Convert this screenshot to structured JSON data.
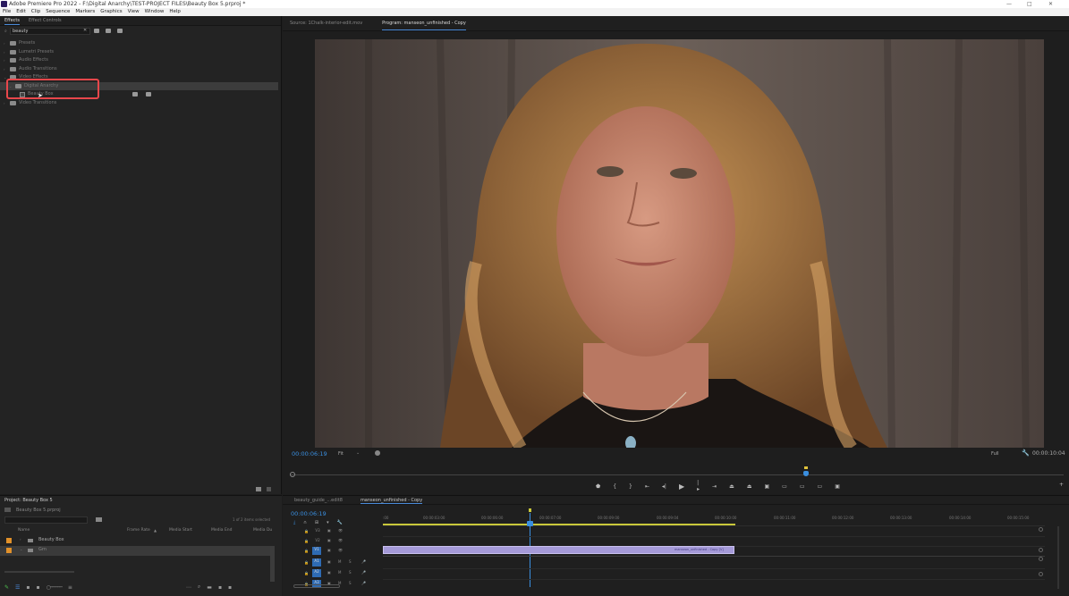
{
  "app": {
    "title": "Adobe Premiere Pro 2022 - F:\\Digital Anarchy\\TEST-PROJECT FILES\\Beauty Box 5.prproj *",
    "window_controls": [
      "—",
      "□",
      "✕"
    ]
  },
  "menu": [
    "File",
    "Edit",
    "Clip",
    "Sequence",
    "Markers",
    "Graphics",
    "View",
    "Window",
    "Help"
  ],
  "effects_panel": {
    "tabs": [
      "Effects",
      "Effect Controls"
    ],
    "search_value": "beauty",
    "tree": [
      {
        "label": "Presets",
        "expanded": false
      },
      {
        "label": "Lumetri Presets",
        "expanded": false
      },
      {
        "label": "Audio Effects",
        "expanded": false
      },
      {
        "label": "Audio Transitions",
        "expanded": false
      },
      {
        "label": "Video Effects",
        "expanded": true
      },
      {
        "label": "Digital Anarchy",
        "expanded": true,
        "selected": true
      },
      {
        "label": "Beauty Box",
        "is_effect": true
      },
      {
        "label": "Video Transitions",
        "expanded": false
      }
    ],
    "highlight_color": "#e8474b"
  },
  "program_monitor": {
    "tabs": [
      "Source: 1Chalk-interior-edit.mov",
      "Program: manseon_unfinished - Copy"
    ],
    "timecode_current": "00:00:06:19",
    "fit": "Fit",
    "quality": "Full",
    "timecode_duration": "00:00:10:04"
  },
  "project_panel": {
    "title": "Project: Beauty Box 5",
    "file": "Beauty Box 5.prproj",
    "selection_info": "1 of 2 items selected",
    "columns": [
      "Name",
      "Frame Rate",
      "Media Start",
      "Media End",
      "Media Du"
    ],
    "items": [
      {
        "name": "Beauty Box",
        "color": "#e0902a"
      },
      {
        "name": "Grn",
        "color": "#e0902a"
      }
    ]
  },
  "timeline": {
    "tabs": [
      "beauty_guide_...edit8",
      "manseon_unfinished - Copy"
    ],
    "timecode": "00:00:06:19",
    "ruler": [
      ":00",
      "00:00:03:00",
      "00:00:06:00",
      "00:00:07:00",
      "00:00:09:00",
      "00:00:09:04",
      "00:00:10:00",
      "00:00:11:00",
      "00:00:12:00",
      "00:00:13:00",
      "00:00:14:00",
      "00:00:15:00"
    ],
    "video_tracks": [
      "V3",
      "V2",
      "V1"
    ],
    "audio_tracks": [
      "A1",
      "A2",
      "A3"
    ],
    "clip_label": "manseon_unfinished - Copy [V]",
    "clip_color": "#a59ad8",
    "accent": "#3a8fe0"
  }
}
